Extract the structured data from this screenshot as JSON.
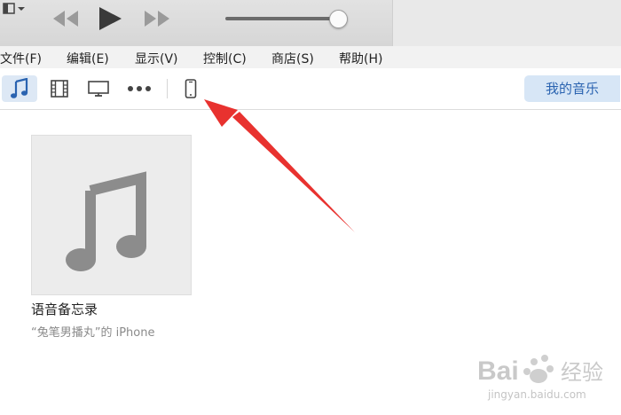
{
  "menu": [
    "文件(F)",
    "编辑(E)",
    "显示(V)",
    "控制(C)",
    "商店(S)",
    "帮助(H)"
  ],
  "toolbar": {
    "media_icons": [
      "music-note-icon",
      "film-icon",
      "tv-icon",
      "more-dots-icon",
      "iphone-device-icon"
    ],
    "my_music_label": "我的音乐"
  },
  "player": {
    "volume_level": 0.92
  },
  "album": {
    "title": "语音备忘录",
    "subtitle": "“兔笔男播丸”的 iPhone"
  },
  "watermark": {
    "text": "Bai 经验",
    "url": "jingyan.baidu.com"
  },
  "colors": {
    "accent_blue": "#2a63b0",
    "active_bg": "#dde8f5",
    "arrow_red": "#e8322f"
  }
}
